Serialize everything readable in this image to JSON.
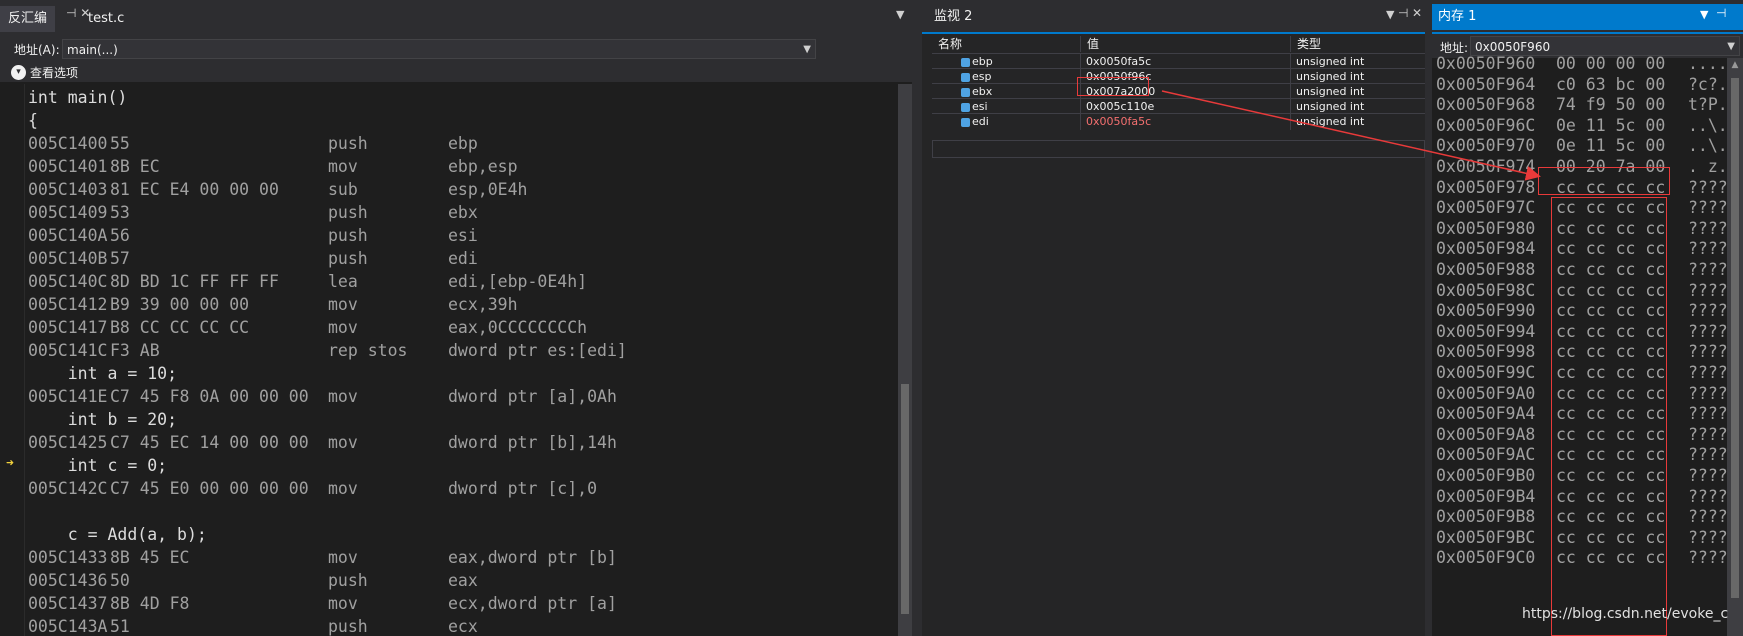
{
  "disasm": {
    "tab_active": "反汇编",
    "tab_pin": "⊣ ✕",
    "tab_file": "test.c",
    "address_label": "地址(A):",
    "address_value": "main(...)",
    "view_options": "查看选项",
    "lines": [
      {
        "kind": "src",
        "text": "int main()"
      },
      {
        "kind": "src",
        "text": "{"
      },
      {
        "kind": "asm",
        "addr": "005C1400",
        "bytes": "55",
        "mn": "push",
        "op": "ebp"
      },
      {
        "kind": "asm",
        "addr": "005C1401",
        "bytes": "8B EC",
        "mn": "mov",
        "op": "ebp,esp"
      },
      {
        "kind": "asm",
        "addr": "005C1403",
        "bytes": "81 EC E4 00 00 00",
        "mn": "sub",
        "op": "esp,0E4h"
      },
      {
        "kind": "asm",
        "addr": "005C1409",
        "bytes": "53",
        "mn": "push",
        "op": "ebx"
      },
      {
        "kind": "asm",
        "addr": "005C140A",
        "bytes": "56",
        "mn": "push",
        "op": "esi"
      },
      {
        "kind": "asm",
        "addr": "005C140B",
        "bytes": "57",
        "mn": "push",
        "op": "edi"
      },
      {
        "kind": "asm",
        "addr": "005C140C",
        "bytes": "8D BD 1C FF FF FF",
        "mn": "lea",
        "op": "edi,[ebp-0E4h]"
      },
      {
        "kind": "asm",
        "addr": "005C1412",
        "bytes": "B9 39 00 00 00",
        "mn": "mov",
        "op": "ecx,39h"
      },
      {
        "kind": "asm",
        "addr": "005C1417",
        "bytes": "B8 CC CC CC CC",
        "mn": "mov",
        "op": "eax,0CCCCCCCCh"
      },
      {
        "kind": "asm",
        "addr": "005C141C",
        "bytes": "F3 AB",
        "mn": "rep stos",
        "op": "dword ptr es:[edi]"
      },
      {
        "kind": "src",
        "text": "    int a = 10;"
      },
      {
        "kind": "asm",
        "addr": "005C141E",
        "bytes": "C7 45 F8 0A 00 00 00",
        "mn": "mov",
        "op": "dword ptr [a],0Ah"
      },
      {
        "kind": "src",
        "text": "    int b = 20;"
      },
      {
        "kind": "asm",
        "addr": "005C1425",
        "bytes": "C7 45 EC 14 00 00 00",
        "mn": "mov",
        "op": "dword ptr [b],14h"
      },
      {
        "kind": "src",
        "text": "    int c = 0;"
      },
      {
        "kind": "asm",
        "addr": "005C142C",
        "bytes": "C7 45 E0 00 00 00 00",
        "mn": "mov",
        "op": "dword ptr [c],0"
      },
      {
        "kind": "src",
        "text": ""
      },
      {
        "kind": "src",
        "text": "    c = Add(a, b);"
      },
      {
        "kind": "asm",
        "addr": "005C1433",
        "bytes": "8B 45 EC",
        "mn": "mov",
        "op": "eax,dword ptr [b]"
      },
      {
        "kind": "asm",
        "addr": "005C1436",
        "bytes": "50",
        "mn": "push",
        "op": "eax"
      },
      {
        "kind": "asm",
        "addr": "005C1437",
        "bytes": "8B 4D F8",
        "mn": "mov",
        "op": "ecx,dword ptr [a]"
      },
      {
        "kind": "asm",
        "addr": "005C143A",
        "bytes": "51",
        "mn": "push",
        "op": "ecx"
      }
    ]
  },
  "watch": {
    "tab": "监视 2",
    "columns": {
      "name": "名称",
      "value": "值",
      "type": "类型"
    },
    "rows": [
      {
        "name": "ebp",
        "value": "0x0050fa5c",
        "type": "unsigned int",
        "changed": false
      },
      {
        "name": "esp",
        "value": "0x0050f96c",
        "type": "unsigned int",
        "changed": false
      },
      {
        "name": "ebx",
        "value": "0x007a2000",
        "type": "unsigned int",
        "changed": false
      },
      {
        "name": "esi",
        "value": "0x005c110e",
        "type": "unsigned int",
        "changed": false
      },
      {
        "name": "edi",
        "value": "0x0050fa5c",
        "type": "unsigned int",
        "changed": true
      }
    ],
    "changed_color": "#f47070"
  },
  "memory": {
    "tab": "内存 1",
    "address_label": "地址:",
    "address_value": "0x0050F960",
    "rows": [
      {
        "addr": "0x0050F960",
        "bytes": "00 00 00 00",
        "ascii": "...."
      },
      {
        "addr": "0x0050F964",
        "bytes": "c0 63 bc 00",
        "ascii": "?c?."
      },
      {
        "addr": "0x0050F968",
        "bytes": "74 f9 50 00",
        "ascii": "t?P."
      },
      {
        "addr": "0x0050F96C",
        "bytes": "0e 11 5c 00",
        "ascii": "..\\."
      },
      {
        "addr": "0x0050F970",
        "bytes": "0e 11 5c 00",
        "ascii": "..\\."
      },
      {
        "addr": "0x0050F974",
        "bytes": "00 20 7a 00",
        "ascii": ". z."
      },
      {
        "addr": "0x0050F978",
        "bytes": "cc cc cc cc",
        "ascii": "????"
      },
      {
        "addr": "0x0050F97C",
        "bytes": "cc cc cc cc",
        "ascii": "????"
      },
      {
        "addr": "0x0050F980",
        "bytes": "cc cc cc cc",
        "ascii": "????"
      },
      {
        "addr": "0x0050F984",
        "bytes": "cc cc cc cc",
        "ascii": "????"
      },
      {
        "addr": "0x0050F988",
        "bytes": "cc cc cc cc",
        "ascii": "????"
      },
      {
        "addr": "0x0050F98C",
        "bytes": "cc cc cc cc",
        "ascii": "????"
      },
      {
        "addr": "0x0050F990",
        "bytes": "cc cc cc cc",
        "ascii": "????"
      },
      {
        "addr": "0x0050F994",
        "bytes": "cc cc cc cc",
        "ascii": "????"
      },
      {
        "addr": "0x0050F998",
        "bytes": "cc cc cc cc",
        "ascii": "????"
      },
      {
        "addr": "0x0050F99C",
        "bytes": "cc cc cc cc",
        "ascii": "????"
      },
      {
        "addr": "0x0050F9A0",
        "bytes": "cc cc cc cc",
        "ascii": "????"
      },
      {
        "addr": "0x0050F9A4",
        "bytes": "cc cc cc cc",
        "ascii": "????"
      },
      {
        "addr": "0x0050F9A8",
        "bytes": "cc cc cc cc",
        "ascii": "????"
      },
      {
        "addr": "0x0050F9AC",
        "bytes": "cc cc cc cc",
        "ascii": "????"
      },
      {
        "addr": "0x0050F9B0",
        "bytes": "cc cc cc cc",
        "ascii": "????"
      },
      {
        "addr": "0x0050F9B4",
        "bytes": "cc cc cc cc",
        "ascii": "????"
      },
      {
        "addr": "0x0050F9B8",
        "bytes": "cc cc cc cc",
        "ascii": "????"
      },
      {
        "addr": "0x0050F9BC",
        "bytes": "cc cc cc cc",
        "ascii": "????"
      },
      {
        "addr": "0x0050F9C0",
        "bytes": "cc cc cc cc",
        "ascii": "????"
      }
    ]
  },
  "watermark": "https://blog.csdn.net/evoke_c",
  "icons": {
    "ip_arrow": "instruction-pointer-arrow-icon",
    "watch_var": "variable-cube-icon",
    "pin": "pin-icon",
    "dropdown": "chevron-down-icon"
  },
  "colors": {
    "accent": "#007acc",
    "annotation": "#e83a3a",
    "ip_arrow": "#f2d23d"
  }
}
